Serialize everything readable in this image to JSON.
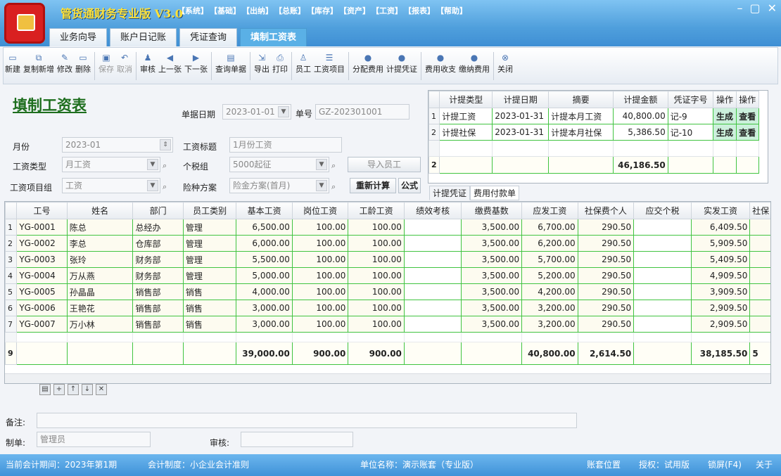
{
  "app": {
    "title": "管货通财务专业版 V3.0",
    "menus": [
      "【系统】",
      "【基础】",
      "【出纳】",
      "【总账】",
      "【库存】",
      "【资产】",
      "【工资】",
      "【报表】",
      "【帮助】"
    ],
    "min": "–",
    "max": "▢",
    "close": "✕"
  },
  "tabs": [
    "业务向导",
    "账户日记账",
    "凭证查询",
    "填制工资表"
  ],
  "toolbar": [
    {
      "label": "新建",
      "icon": "new-icon",
      "glyph": "▭"
    },
    {
      "label": "复制新增",
      "icon": "copy-icon",
      "glyph": "⧉"
    },
    {
      "label": "修改",
      "icon": "edit-icon",
      "glyph": "✎"
    },
    {
      "label": "删除",
      "icon": "delete-icon",
      "glyph": "▭"
    },
    {
      "label": "保存",
      "icon": "save-icon",
      "glyph": "▣",
      "disabled": true
    },
    {
      "label": "取消",
      "icon": "undo-icon",
      "glyph": "↶",
      "disabled": true
    },
    {
      "label": "审核",
      "icon": "audit-icon",
      "glyph": "♟"
    },
    {
      "label": "上一张",
      "icon": "prev-icon",
      "glyph": "◀"
    },
    {
      "label": "下一张",
      "icon": "next-icon",
      "glyph": "▶"
    },
    {
      "label": "查询单据",
      "icon": "query-icon",
      "glyph": "▤"
    },
    {
      "label": "导出",
      "icon": "export-icon",
      "glyph": "⇲",
      "dd": true
    },
    {
      "label": "打印",
      "icon": "print-icon",
      "glyph": "⎙",
      "dd": true
    },
    {
      "label": "员工",
      "icon": "employee-icon",
      "glyph": "♙"
    },
    {
      "label": "工资项目",
      "icon": "list-icon",
      "glyph": "☰"
    },
    {
      "label": "分配费用",
      "icon": "allocate-icon",
      "glyph": "●"
    },
    {
      "label": "计提凭证",
      "icon": "voucher-icon",
      "glyph": "●"
    },
    {
      "label": "费用收支",
      "icon": "expense-icon",
      "glyph": "●"
    },
    {
      "label": "缴纳费用",
      "icon": "pay-icon",
      "glyph": "●"
    },
    {
      "label": "关闭",
      "icon": "close-icon",
      "glyph": "⊗"
    }
  ],
  "form": {
    "title": "填制工资表",
    "date_label": "单据日期",
    "date_value": "2023-01-01",
    "no_label": "单号",
    "no_value": "GZ-202301001",
    "month_label": "月份",
    "month_value": "2023-01",
    "salary_title_label": "工资标题",
    "salary_title_value": "1月份工资",
    "type_label": "工资类型",
    "type_value": "月工资",
    "tax_label": "个税组",
    "tax_value": "5000起征",
    "import_btn": "导入员工",
    "group_label": "工资项目组",
    "group_value": "工资",
    "ins_label": "险种方案",
    "ins_value": "险金方案(首月)",
    "recalc_btn": "重新计算",
    "formula_btn": "公式"
  },
  "accrual": {
    "headers": [
      "",
      "计提类型",
      "计提日期",
      "摘要",
      "计提金额",
      "凭证字号",
      "操作",
      "操作"
    ],
    "rows": [
      [
        "1",
        "计提工资",
        "2023-01-31",
        "计提本月工资",
        "40,800.00",
        "记-9",
        "生成",
        "查看"
      ],
      [
        "2",
        "计提社保",
        "2023-01-31",
        "计提本月社保",
        "5,386.50",
        "记-10",
        "生成",
        "查看"
      ]
    ],
    "sum": [
      "2",
      "",
      "",
      "",
      "46,186.50",
      "",
      "",
      ""
    ],
    "tabs": [
      "计提凭证",
      "费用付款单"
    ]
  },
  "main": {
    "headers": [
      "",
      "工号",
      "姓名",
      "部门",
      "员工类别",
      "基本工资",
      "岗位工资",
      "工龄工资",
      "绩效考核",
      "缴费基数",
      "应发工资",
      "社保费个人",
      "应交个税",
      "实发工资",
      "社保"
    ],
    "rows": [
      [
        "1",
        "YG-0001",
        "陈总",
        "总经办",
        "管理",
        "6,500.00",
        "100.00",
        "100.00",
        "",
        "3,500.00",
        "6,700.00",
        "290.50",
        "",
        "6,409.50",
        ""
      ],
      [
        "2",
        "YG-0002",
        "李总",
        "仓库部",
        "管理",
        "6,000.00",
        "100.00",
        "100.00",
        "",
        "3,500.00",
        "6,200.00",
        "290.50",
        "",
        "5,909.50",
        ""
      ],
      [
        "3",
        "YG-0003",
        "张玲",
        "财务部",
        "管理",
        "5,500.00",
        "100.00",
        "100.00",
        "",
        "3,500.00",
        "5,700.00",
        "290.50",
        "",
        "5,409.50",
        ""
      ],
      [
        "4",
        "YG-0004",
        "万从燕",
        "财务部",
        "管理",
        "5,000.00",
        "100.00",
        "100.00",
        "",
        "3,500.00",
        "5,200.00",
        "290.50",
        "",
        "4,909.50",
        ""
      ],
      [
        "5",
        "YG-0005",
        "孙晶晶",
        "销售部",
        "销售",
        "4,000.00",
        "100.00",
        "100.00",
        "",
        "3,500.00",
        "4,200.00",
        "290.50",
        "",
        "3,909.50",
        ""
      ],
      [
        "6",
        "YG-0006",
        "王艳花",
        "销售部",
        "销售",
        "3,000.00",
        "100.00",
        "100.00",
        "",
        "3,500.00",
        "3,200.00",
        "290.50",
        "",
        "2,909.50",
        ""
      ],
      [
        "7",
        "YG-0007",
        "万小林",
        "销售部",
        "销售",
        "3,000.00",
        "100.00",
        "100.00",
        "",
        "3,500.00",
        "3,200.00",
        "290.50",
        "",
        "2,909.50",
        ""
      ]
    ],
    "sum": [
      "9",
      "",
      "",
      "",
      "",
      "39,000.00",
      "900.00",
      "900.00",
      "",
      "",
      "40,800.00",
      "2,614.50",
      "",
      "38,185.50",
      "5"
    ]
  },
  "footer": {
    "remark_label": "备注:",
    "maker_label": "制单:",
    "maker_value": "管理员",
    "auditor_label": "审核:"
  },
  "status": {
    "period": "当前会计期间：2023年第1期",
    "system": "会计制度：小企业会计准则",
    "unit": "单位名称：演示账套（专业版）",
    "location": "账套位置",
    "license": "授权：试用版",
    "lock": "锁屏(F4)",
    "about": "关于"
  }
}
